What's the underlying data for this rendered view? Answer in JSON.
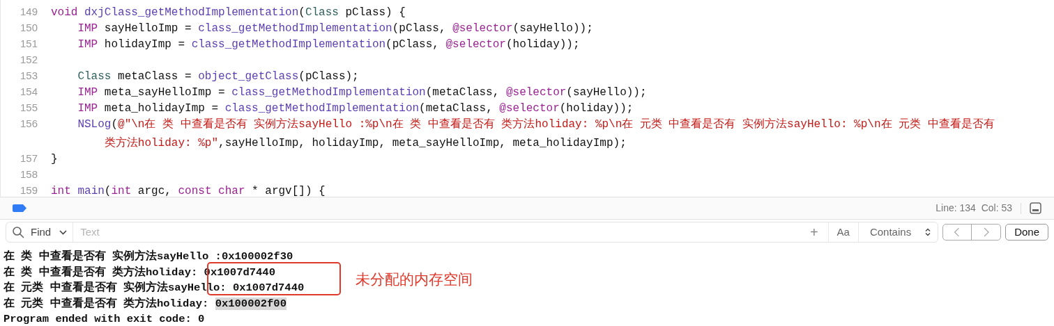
{
  "editor": {
    "lines": [
      {
        "number": "149",
        "rows": [
          [
            {
              "kind": "keyword",
              "text": "void"
            },
            {
              "kind": "plain",
              "text": " "
            },
            {
              "kind": "function",
              "text": "dxjClass_getMethodImplementation"
            },
            {
              "kind": "plain",
              "text": "("
            },
            {
              "kind": "type",
              "text": "Class"
            },
            {
              "kind": "plain",
              "text": " pClass) {"
            }
          ]
        ]
      },
      {
        "number": "150",
        "rows": [
          [
            {
              "kind": "keyword",
              "text": "    IMP"
            },
            {
              "kind": "plain",
              "text": " sayHelloImp = "
            },
            {
              "kind": "function",
              "text": "class_getMethodImplementation"
            },
            {
              "kind": "plain",
              "text": "(pClass, "
            },
            {
              "kind": "keyword",
              "text": "@selector"
            },
            {
              "kind": "plain",
              "text": "(sayHello));"
            }
          ]
        ]
      },
      {
        "number": "151",
        "rows": [
          [
            {
              "kind": "keyword",
              "text": "    IMP"
            },
            {
              "kind": "plain",
              "text": " holidayImp = "
            },
            {
              "kind": "function",
              "text": "class_getMethodImplementation"
            },
            {
              "kind": "plain",
              "text": "(pClass, "
            },
            {
              "kind": "keyword",
              "text": "@selector"
            },
            {
              "kind": "plain",
              "text": "(holiday));"
            }
          ]
        ]
      },
      {
        "number": "152"
      },
      {
        "number": "153",
        "rows": [
          [
            {
              "kind": "type",
              "text": "    Class"
            },
            {
              "kind": "plain",
              "text": " metaClass = "
            },
            {
              "kind": "function",
              "text": "object_getClass"
            },
            {
              "kind": "plain",
              "text": "(pClass);"
            }
          ]
        ]
      },
      {
        "number": "154",
        "rows": [
          [
            {
              "kind": "keyword",
              "text": "    IMP"
            },
            {
              "kind": "plain",
              "text": " meta_sayHelloImp = "
            },
            {
              "kind": "function",
              "text": "class_getMethodImplementation"
            },
            {
              "kind": "plain",
              "text": "(metaClass, "
            },
            {
              "kind": "keyword",
              "text": "@selector"
            },
            {
              "kind": "plain",
              "text": "(sayHello));"
            }
          ]
        ]
      },
      {
        "number": "155",
        "rows": [
          [
            {
              "kind": "keyword",
              "text": "    IMP"
            },
            {
              "kind": "plain",
              "text": " meta_holidayImp = "
            },
            {
              "kind": "function",
              "text": "class_getMethodImplementation"
            },
            {
              "kind": "plain",
              "text": "(metaClass, "
            },
            {
              "kind": "keyword",
              "text": "@selector"
            },
            {
              "kind": "plain",
              "text": "(holiday));"
            }
          ]
        ]
      },
      {
        "number": "156",
        "rows": [
          [
            {
              "kind": "function",
              "text": "    NSLog"
            },
            {
              "kind": "plain",
              "text": "("
            },
            {
              "kind": "string",
              "text": "@\"\\n在 类 中查看是否有 实例方法sayHello :%p\\n在 类 中查看是否有 类方法holiday: %p\\n在 元类 中查看是否有 实例方法sayHello: %p\\n在 元类 中查看是否有"
            }
          ]
        ],
        "wrapped": {
          "tokens": [
            {
              "kind": "string",
              "text": "        类方法holiday: %p\""
            },
            {
              "kind": "plain",
              "text": ",sayHelloImp, holidayImp, meta_sayHelloImp, meta_holidayImp);"
            }
          ]
        }
      },
      {
        "number": "157",
        "rows": [
          [
            {
              "kind": "plain",
              "text": "}"
            }
          ]
        ]
      },
      {
        "number": "158"
      },
      {
        "number": "159",
        "rows": [
          [
            {
              "kind": "keyword",
              "text": "int"
            },
            {
              "kind": "plain",
              "text": " "
            },
            {
              "kind": "function",
              "text": "main"
            },
            {
              "kind": "plain",
              "text": "("
            },
            {
              "kind": "keyword",
              "text": "int"
            },
            {
              "kind": "plain",
              "text": " argc, "
            },
            {
              "kind": "keyword",
              "text": "const"
            },
            {
              "kind": "plain",
              "text": " "
            },
            {
              "kind": "keyword",
              "text": "char"
            },
            {
              "kind": "plain",
              "text": " * argv[]) {"
            }
          ]
        ]
      }
    ]
  },
  "status_bar": {
    "position": "Line: 134  Col: 53"
  },
  "find_bar": {
    "mode": "Find",
    "placeholder": "Text",
    "add": "+",
    "case_toggle": "Aa",
    "match": "Contains",
    "done": "Done"
  },
  "console": {
    "lines": [
      [
        {
          "text": "在 类 中查看是否有 实例方法sayHello :0x100002f30",
          "highlighted": false
        }
      ],
      [
        {
          "text": "在 类 中查看是否有 类方法holiday: 0x1007d7440",
          "highlighted": false
        }
      ],
      [
        {
          "text": "在 元类 中查看是否有 实例方法sayHello: 0x1007d7440",
          "highlighted": false
        }
      ],
      [
        {
          "text": "在 元类 中查看是否有 类方法holiday: ",
          "highlighted": false
        },
        {
          "text": "0x100002f00",
          "highlighted": true
        }
      ],
      [
        {
          "text": "Program ended with exit code: 0",
          "highlighted": false
        }
      ]
    ],
    "annotation": "未分配的内存空间"
  }
}
